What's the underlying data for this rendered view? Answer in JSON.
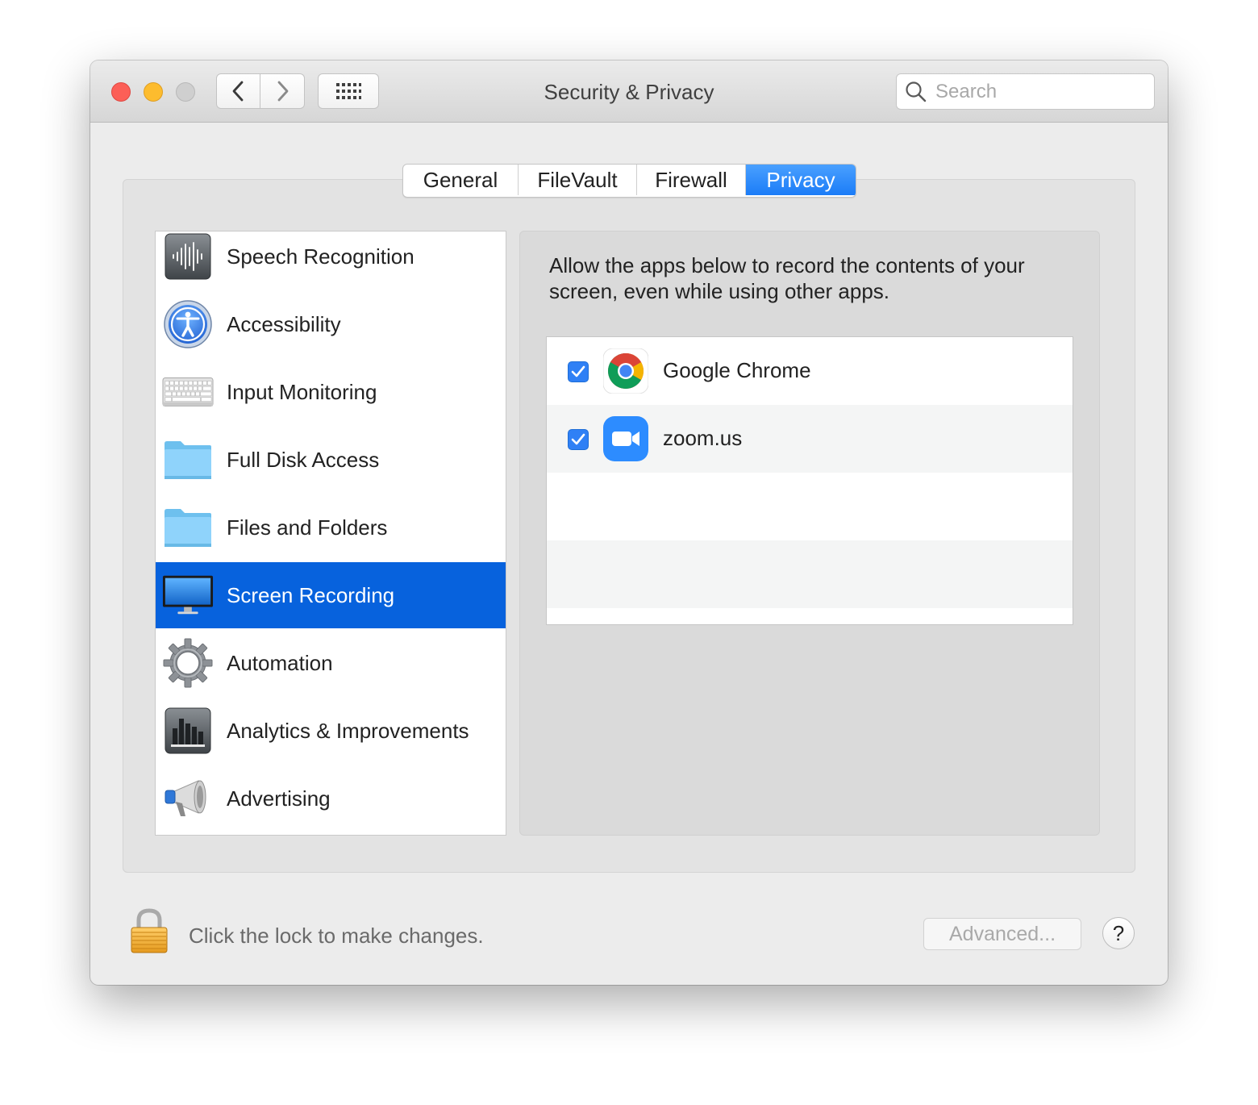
{
  "window": {
    "title": "Security & Privacy",
    "search_placeholder": "Search"
  },
  "tabs": [
    {
      "label": "General",
      "active": false
    },
    {
      "label": "FileVault",
      "active": false
    },
    {
      "label": "Firewall",
      "active": false
    },
    {
      "label": "Privacy",
      "active": true
    }
  ],
  "sidebar": {
    "items": [
      {
        "label": "Speech Recognition",
        "icon": "speech-recognition-icon"
      },
      {
        "label": "Accessibility",
        "icon": "accessibility-icon"
      },
      {
        "label": "Input Monitoring",
        "icon": "keyboard-icon"
      },
      {
        "label": "Full Disk Access",
        "icon": "folder-icon"
      },
      {
        "label": "Files and Folders",
        "icon": "folder-icon"
      },
      {
        "label": "Screen Recording",
        "icon": "display-icon",
        "selected": true
      },
      {
        "label": "Automation",
        "icon": "gear-icon"
      },
      {
        "label": "Analytics & Improvements",
        "icon": "bar-chart-icon"
      },
      {
        "label": "Advertising",
        "icon": "megaphone-icon"
      }
    ]
  },
  "content": {
    "description": "Allow the apps below to record the contents of your screen, even while using other apps.",
    "apps": [
      {
        "name": "Google Chrome",
        "checked": true,
        "icon": "chrome-icon"
      },
      {
        "name": "zoom.us",
        "checked": true,
        "icon": "zoom-icon"
      }
    ]
  },
  "footer": {
    "lock_text": "Click the lock to make changes.",
    "advanced_label": "Advanced...",
    "help_label": "?"
  },
  "colors": {
    "selection": "#0762dd",
    "tab_active": "#1b7cf7",
    "checkbox": "#2f80f5",
    "close": "#fc5f57",
    "minimize": "#fdbc2e"
  }
}
